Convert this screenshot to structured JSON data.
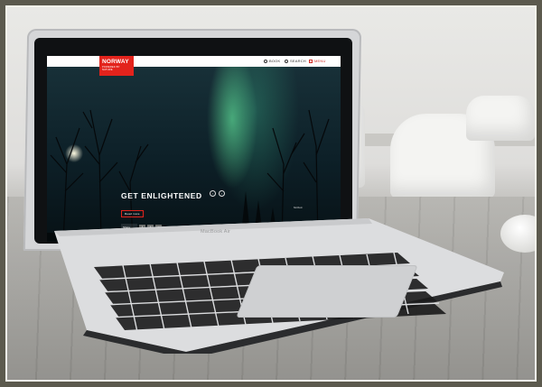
{
  "scene": {
    "description_tags": [
      "laptop-mockup",
      "office-background"
    ],
    "device_label": "MacBook Air"
  },
  "website": {
    "logo": {
      "name": "NORWAY",
      "tagline": "POWERED BY NATURE"
    },
    "nav": [
      {
        "label": "BOOK",
        "icon": "calendar-icon"
      },
      {
        "label": "SEARCH",
        "icon": "search-icon"
      },
      {
        "label": "MENU",
        "icon": "menu-icon"
      }
    ],
    "hero": {
      "headline": "GET ENLIGHTENED",
      "read_more": "Read more",
      "caption": "Northern"
    },
    "share": {
      "label": "Share",
      "buttons": [
        "f",
        "t",
        "g"
      ]
    }
  },
  "colors": {
    "brand_red": "#e3231c",
    "frame": "#5c5a4e"
  }
}
